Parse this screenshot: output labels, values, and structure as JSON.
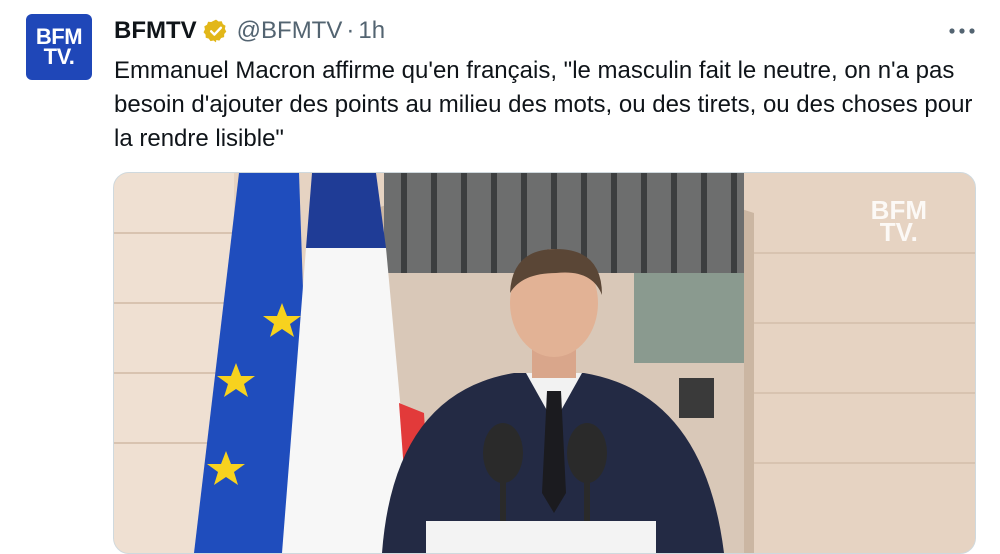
{
  "author": {
    "avatar_text_line1": "BFM",
    "avatar_text_line2": "TV.",
    "display_name": "BFMTV",
    "handle": "@BFMTV",
    "separator": "·",
    "time": "1h",
    "verified_icon": "verified-badge-icon"
  },
  "tweet": {
    "text": "Emmanuel Macron affirme qu'en français, \"le masculin fait le neutre, on n'a pas besoin d'ajouter des points au milieu des mots, ou des tirets, ou des choses pour la rendre lisible\""
  },
  "more_icon": "more-options-icon",
  "media": {
    "watermark_line1": "BFM",
    "watermark_line2": "TV."
  },
  "colors": {
    "brand": "#1f47b8",
    "verified": "#e2b719",
    "text": "#0f1419",
    "muted": "#536471"
  }
}
